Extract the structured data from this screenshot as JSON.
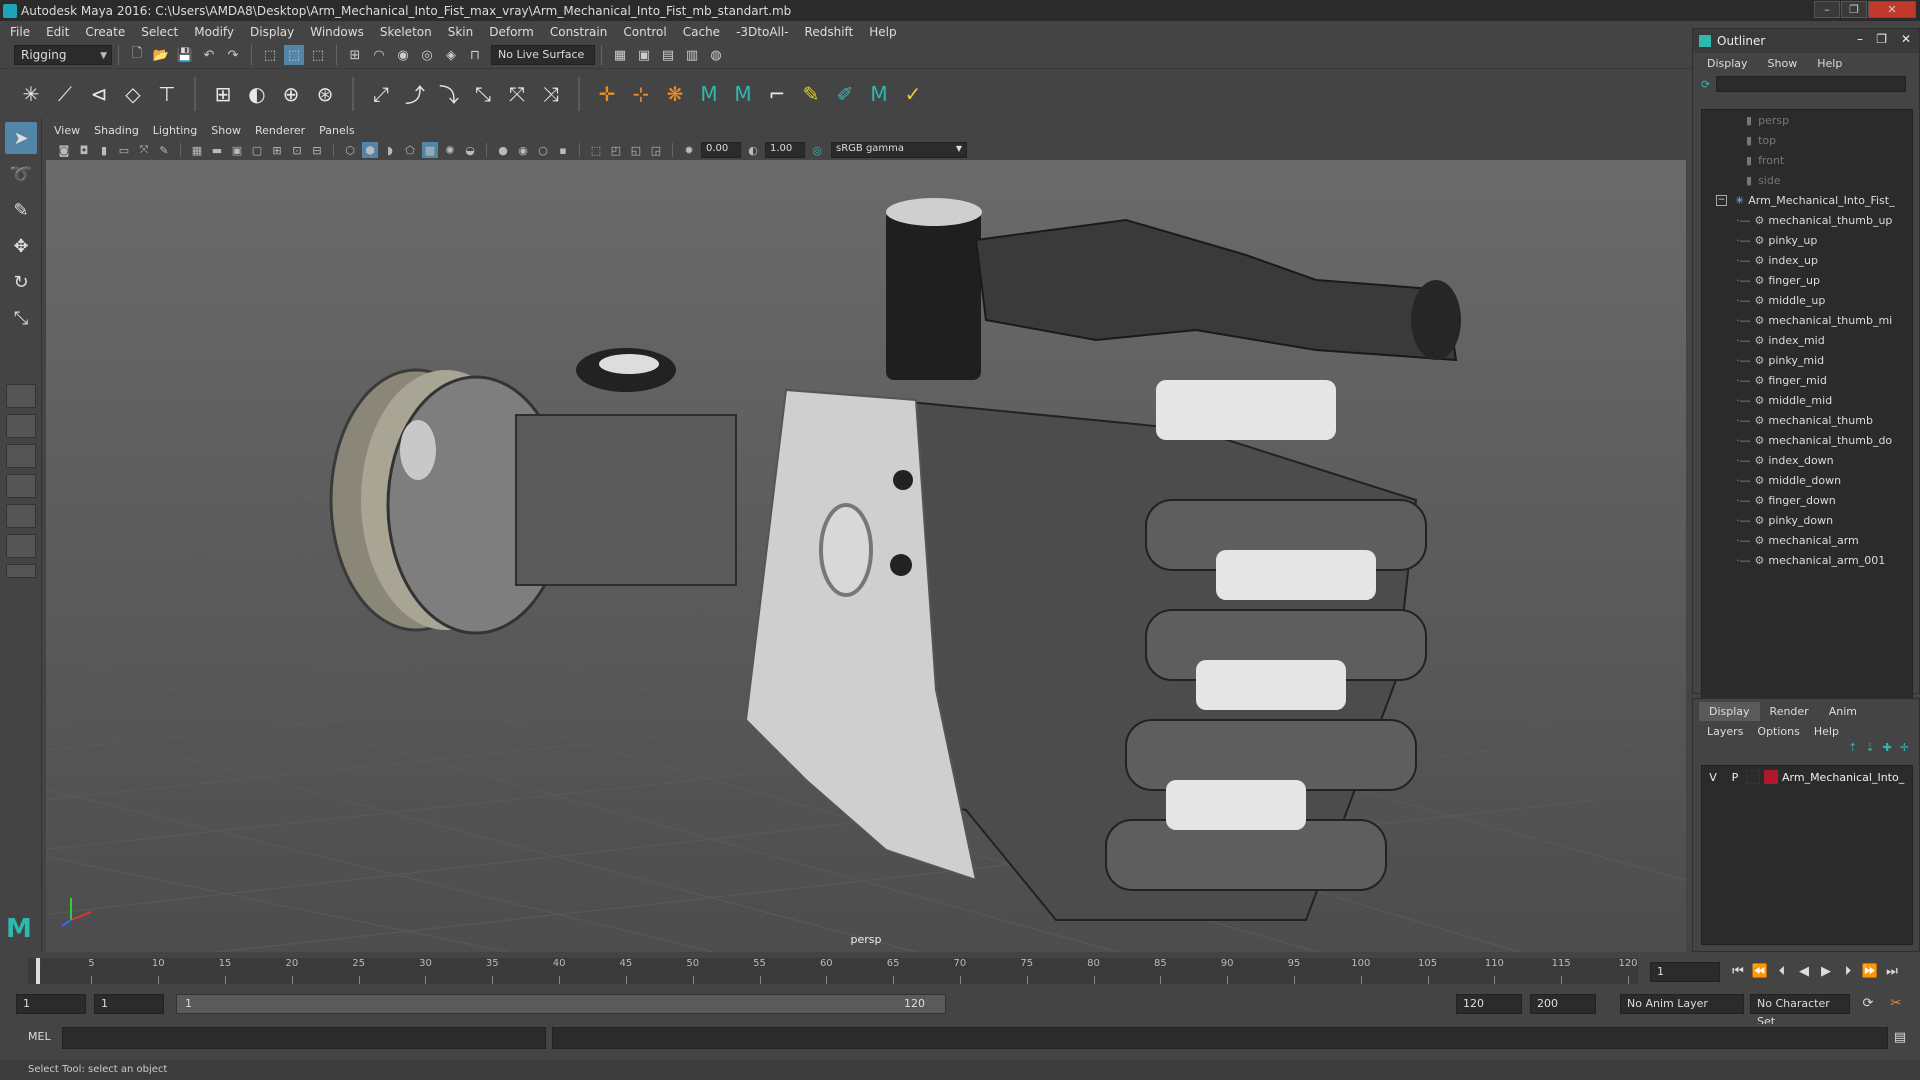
{
  "titlebar": {
    "title": "Autodesk Maya 2016: C:\\Users\\AMDA8\\Desktop\\Arm_Mechanical_Into_Fist_max_vray\\Arm_Mechanical_Into_Fist_mb_standart.mb"
  },
  "menubar": [
    "File",
    "Edit",
    "Create",
    "Select",
    "Modify",
    "Display",
    "Windows",
    "Skeleton",
    "Skin",
    "Deform",
    "Constrain",
    "Control",
    "Cache",
    "-3DtoAll-",
    "Redshift",
    "Help"
  ],
  "statusline": {
    "mode": "Rigging",
    "live_surface": "No Live Surface"
  },
  "viewport": {
    "menu": [
      "View",
      "Shading",
      "Lighting",
      "Show",
      "Renderer",
      "Panels"
    ],
    "exposure": "0.00",
    "gamma": "1.00",
    "color_space": "sRGB gamma",
    "camera": "persp"
  },
  "outliner": {
    "title": "Outliner",
    "menu": [
      "Display",
      "Show",
      "Help"
    ],
    "cameras": [
      "persp",
      "top",
      "front",
      "side"
    ],
    "group": "Arm_Mechanical_Into_Fist_",
    "children": [
      "mechanical_thumb_up",
      "pinky_up",
      "index_up",
      "finger_up",
      "middle_up",
      "mechanical_thumb_mi",
      "index_mid",
      "pinky_mid",
      "finger_mid",
      "middle_mid",
      "mechanical_thumb",
      "mechanical_thumb_do",
      "index_down",
      "middle_down",
      "finger_down",
      "pinky_down",
      "mechanical_arm",
      "mechanical_arm_001"
    ]
  },
  "layers": {
    "tabs": [
      "Display",
      "Render",
      "Anim"
    ],
    "menu": [
      "Layers",
      "Options",
      "Help"
    ],
    "row": {
      "v": "V",
      "p": "P",
      "name": "Arm_Mechanical_Into_",
      "color": "#b0182f"
    }
  },
  "timeline": {
    "ticks": [
      "1",
      "5",
      "10",
      "15",
      "20",
      "25",
      "30",
      "35",
      "40",
      "45",
      "50",
      "55",
      "60",
      "65",
      "70",
      "75",
      "80",
      "85",
      "90",
      "95",
      "100",
      "105",
      "110",
      "115",
      "120"
    ],
    "current_frame": "1"
  },
  "range": {
    "start": "1",
    "playback_start": "1",
    "slider_start": "1",
    "slider_end": "120",
    "playback_end": "120",
    "end": "200",
    "anim_layer": "No Anim Layer",
    "char_set": "No Character Set"
  },
  "cmdline": {
    "lang": "MEL"
  },
  "helpline": {
    "text": "Select Tool: select an object"
  }
}
